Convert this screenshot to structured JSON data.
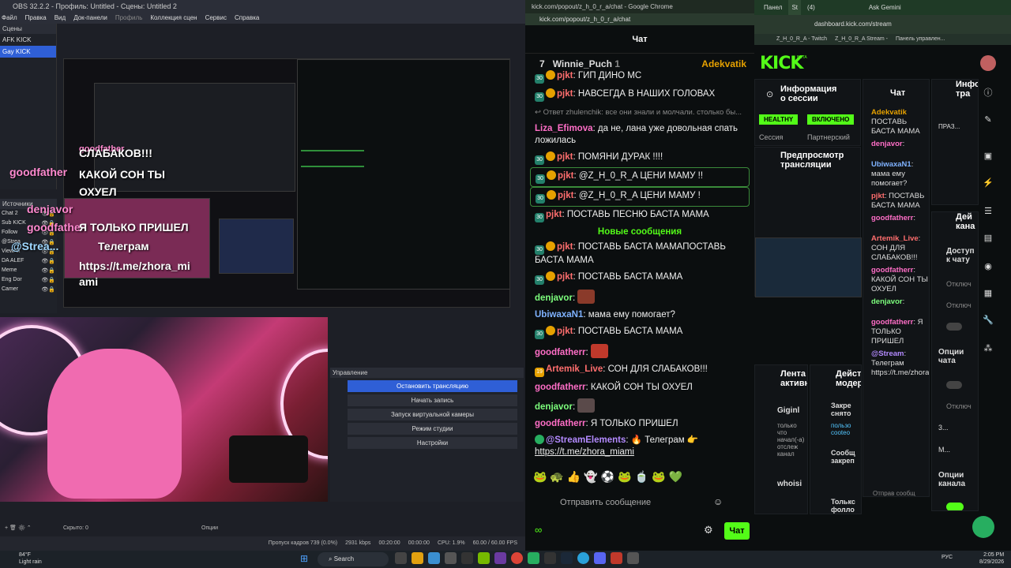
{
  "obs": {
    "title": "OBS 32.2.2 - Профиль: Untitled - Сцены: Untitled 2",
    "menu": [
      "Файл",
      "Правка",
      "Вид",
      "Док-панели",
      "Профиль",
      "Коллекция сцен",
      "Сервис",
      "Справка"
    ],
    "scenes_header": "Сцены",
    "scenes": [
      "AFK KICK",
      "Gay KICK"
    ],
    "sources_header": "Источники",
    "sources": [
      "Chat 2",
      "Sub KICK",
      "Follow",
      "@Strea",
      "ViewAlt",
      "DA ALEF",
      "Meme",
      "Eng Dor",
      "Camer"
    ],
    "overlay_name_1": "goodfather",
    "overlay_text_1": "СЛАБАКОВ!!!",
    "overlay_text_2": "КАКОЙ СОН ТЫ ОХУЕЛ",
    "overlay_name_2": "denjavor",
    "overlay_name_3": "goodfather",
    "overlay_text_3": "Я ТОЛЬКО ПРИШЕЛ",
    "overlay_name_4": "@Strea...",
    "overlay_text_4": "Телеграм",
    "overlay_text_5": "https://t.me/zhora_mi ami",
    "controls_header": "Управление",
    "controls": [
      "Остановить трансляцию",
      "Начать запись",
      "Запуск виртуальной камеры",
      "Режим студии",
      "Настройки"
    ],
    "hidden_label": "Скрыто: 0",
    "options_label": "Опции",
    "status": [
      "Пропуск кадров 739 (0.0%)",
      "2931 kbps",
      "00:20:00",
      "00:00:00",
      "CPU: 1.9%",
      "60.00 / 60.00 FPS"
    ]
  },
  "chatwin": {
    "title": "kick.com/popout/z_h_0_r_a/chat - Google Chrome",
    "url": "kick.com/popout/z_h_0_r_a/chat",
    "header": "Чат",
    "pinned_count": "7",
    "pinned_user": "Winnie_Puch",
    "pinned_num": "1",
    "pinned_right": "Adekvatik",
    "messages": [
      {
        "user": "pjkt",
        "text": "ГИП ДИНО МС",
        "hl": false
      },
      {
        "user": "pjkt",
        "text": "НАВСЕГДА В НАШИХ ГОЛОВАХ",
        "hl": false
      },
      {
        "user": "",
        "text": "Ответ zhulenchik: все они знали и молчали. столько бы...",
        "hl": false
      },
      {
        "user": "Liza_Efimova",
        "text": "да не, лана уже довольная спать ложилась",
        "hl": false
      },
      {
        "user": "pjkt",
        "text": "ПОМЯНИ ДУРАК !!!!",
        "hl": false
      },
      {
        "user": "pjkt",
        "text": "@Z_H_0_R_A ЦЕНИ МАМУ !!",
        "hl": true
      },
      {
        "user": "pjkt",
        "text": "@Z_H_0_R_A ЦЕНИ МАМУ !",
        "hl": true
      },
      {
        "user": "pjkt",
        "text": "ПОСТАВЬ ПЕСНЮ БАСТА МАМА",
        "hl": false
      }
    ],
    "new_messages": "Новые сообщения",
    "messages2": [
      {
        "user": "pjkt",
        "text": "ПОСТАВЬ БАСТА МАМАПОСТАВЬ БАСТА МАМА"
      },
      {
        "user": "pjkt",
        "text": "ПОСТАВЬ БАСТА МАМА"
      },
      {
        "user": "denjavor",
        "text": ""
      },
      {
        "user": "UbiwaxaN1",
        "text": "мама ему помогает?"
      },
      {
        "user": "pjkt",
        "text": "ПОСТАВЬ БАСТА МАМА"
      },
      {
        "user": "goodfatherr",
        "text": ""
      },
      {
        "user": "Artemik_Live",
        "text": "СОН ДЛЯ СЛАБАКОВ!!!"
      },
      {
        "user": "goodfatherr",
        "text": "КАКОЙ СОН ТЫ ОХУЕЛ"
      },
      {
        "user": "denjavor",
        "text": ""
      },
      {
        "user": "goodfatherr",
        "text": "Я ТОЛЬКО ПРИШЕЛ"
      },
      {
        "user": "@StreamElements",
        "text": "Телеграм"
      }
    ],
    "link": "https://t.me/zhora_miami",
    "input_placeholder": "Отправить сообщение",
    "send": "Чат"
  },
  "dash": {
    "tabs": [
      "Панел",
      "St",
      "(4)",
      "Ask Gemini"
    ],
    "url": "dashboard.kick.com/stream",
    "bookmarks": [
      "Z_H_0_R_A - Twitch",
      "Z_H_0_R_A Stream -",
      "Панель управлен..."
    ],
    "logo": "KICK",
    "beta": "BETA",
    "session_title": "Информация о сессии",
    "health": "HEALTHY",
    "live": "ВКЛЮЧЕНО",
    "session_label": "Сессия",
    "partner_label": "Партнерский",
    "preview_title": "Предпросмотр трансляции",
    "chat_title": "Чат",
    "info_title": "Инфо тра",
    "actions_title": "Действ модер",
    "feed_title": "Лента активн",
    "feed_items": [
      "Giginl",
      "whoisi",
      "Толькс фолло"
    ],
    "feed_sub": "только что начал(-а) отслеж канал",
    "mod_items": [
      "Закре снято",
      "Сообщ закреп"
    ],
    "mod_sub": "пользо cooteo",
    "mini_chat": [
      {
        "user": "Adekvatik",
        "text": "ПОСТАВЬ БАСТА МАМА"
      },
      {
        "user": "denjavor",
        "text": ""
      },
      {
        "user": "UbiwaxaN1",
        "text": "мама ему помогает?"
      },
      {
        "user": "pjkt",
        "text": "ПОСТАВЬ БАСТА МАМА"
      },
      {
        "user": "goodfatherr",
        "text": ""
      },
      {
        "user": "Artemik_Live",
        "text": "СОН ДЛЯ СЛАБАКОВ!!!"
      },
      {
        "user": "goodfatherr",
        "text": "КАКОЙ СОН ТЫ ОХУЕЛ"
      },
      {
        "user": "denjavor",
        "text": ""
      },
      {
        "user": "goodfatherr",
        "text": "Я ТОЛЬКО ПРИШЕЛ"
      },
      {
        "user": "@Stream",
        "text": "Телеграм https://t.me/zhora_miami"
      }
    ],
    "mini_input": "Отправ сообщ",
    "right_title": "Дей кана",
    "access": "Доступ к чату",
    "off1": "Отключ",
    "off2": "Отключ",
    "chat_opts": "Опции чата",
    "off3": "Отключ",
    "three": "3...",
    "m": "M...",
    "channel_opts": "Опции канала",
    "holiday": "ПРАЗ..."
  },
  "taskbar": {
    "weather": "84°F",
    "weather_sub": "Light rain",
    "search": "Search",
    "lang": "РУС",
    "time": "2:05 PM",
    "date": "8/29/2026"
  }
}
